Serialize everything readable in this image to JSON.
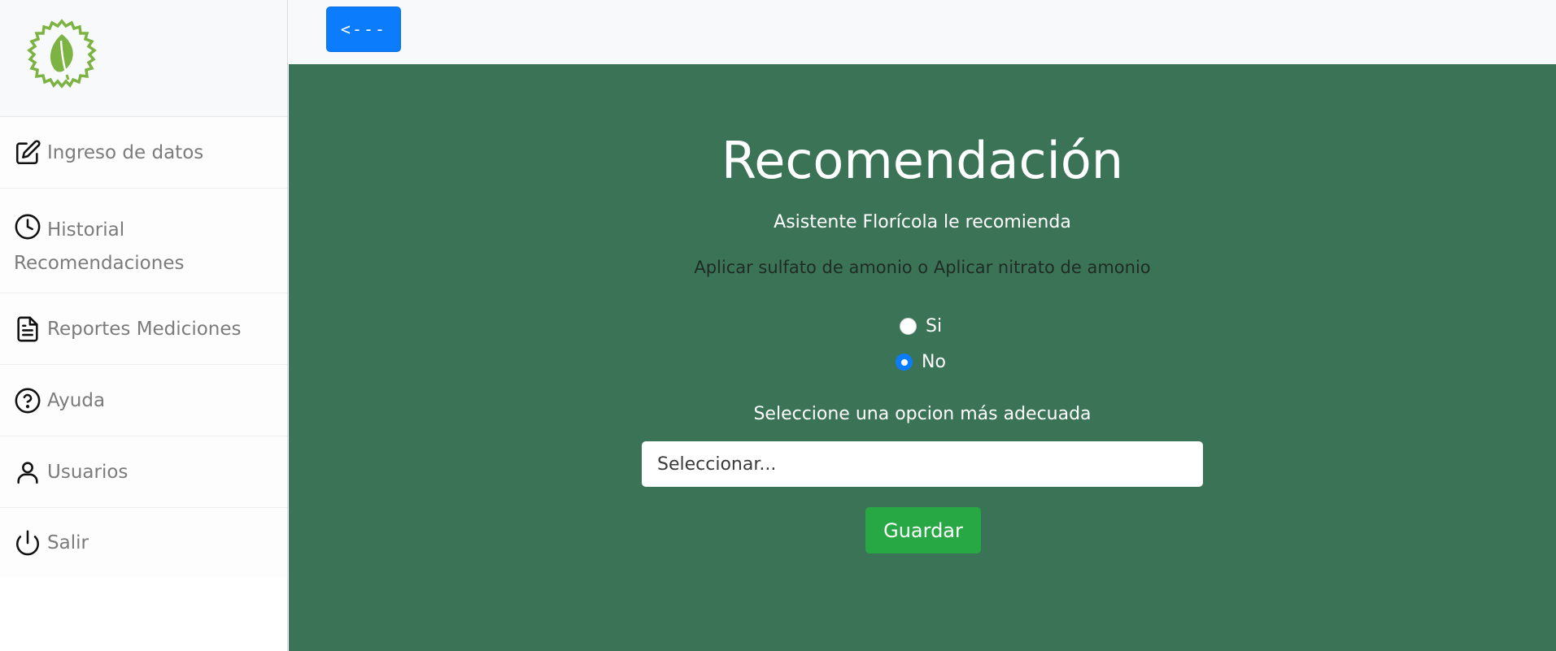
{
  "sidebar": {
    "logo_icon": "leaf-gear-logo",
    "items": [
      {
        "label": "Ingreso de datos",
        "icon": "edit-icon"
      },
      {
        "label": "Historial Recomendaciones",
        "icon": "clock-icon"
      },
      {
        "label": "Reportes Mediciones",
        "icon": "document-icon"
      },
      {
        "label": "Ayuda",
        "icon": "help-icon"
      },
      {
        "label": "Usuarios",
        "icon": "user-icon"
      },
      {
        "label": "Salir",
        "icon": "power-icon"
      }
    ]
  },
  "topbar": {
    "back_label": "<---"
  },
  "main": {
    "title": "Recomendación",
    "subtitle": "Asistente Florícola le recomienda",
    "recommendation": "Aplicar sulfato de amonio o Aplicar nitrato de amonio",
    "options": [
      {
        "label": "Si",
        "checked": false
      },
      {
        "label": "No",
        "checked": true
      }
    ],
    "select_label": "Seleccione una opcion más adecuada",
    "select_value": "Seleccionar...",
    "save_label": "Guardar"
  },
  "colors": {
    "main_bg": "#3b7357",
    "primary": "#0b7dfc",
    "success": "#28a745",
    "logo": "#7cb342"
  }
}
